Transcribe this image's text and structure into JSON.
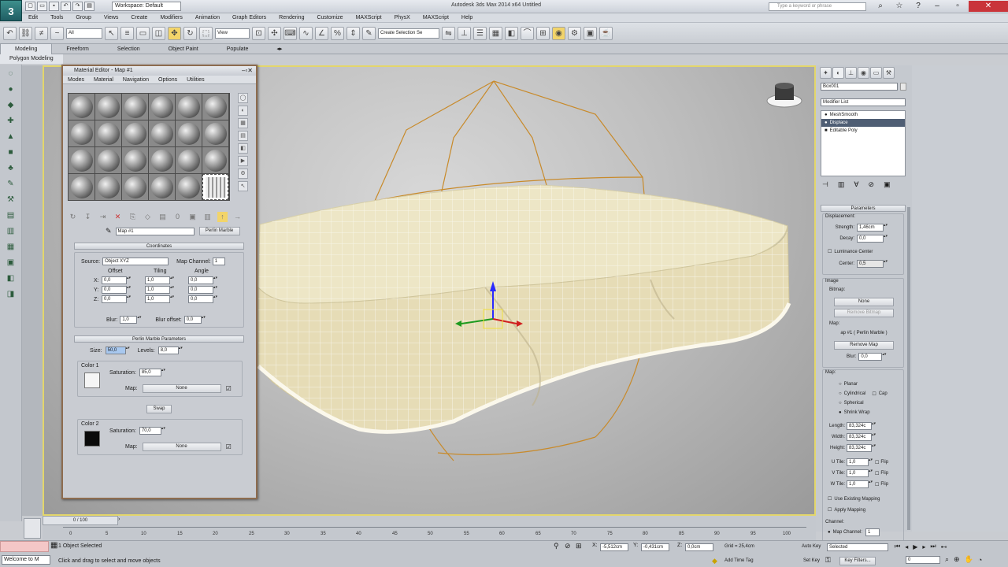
{
  "app": {
    "title": "Autodesk 3ds Max  2014 x64    Untitled",
    "logo": "3",
    "workspace": "Workspace: Default",
    "help_search_placeholder": "Type a keyword or phrase"
  },
  "menubar": [
    "Edit",
    "Tools",
    "Group",
    "Views",
    "Create",
    "Modifiers",
    "Animation",
    "Graph Editors",
    "Rendering",
    "Customize",
    "MAXScript",
    "PhysX",
    "MAXScript",
    "Help"
  ],
  "toolbar": {
    "selection_filter": "All",
    "ref_coord": "View",
    "named_selection": "Create Selection Se"
  },
  "ribbon": {
    "tabs": [
      "Modeling",
      "Freeform",
      "Selection",
      "Object Paint",
      "Populate"
    ],
    "active_tab": "Modeling",
    "sub": "Polygon Modeling"
  },
  "material_editor": {
    "title": "Material Editor - Map #1",
    "menu": [
      "Modes",
      "Material",
      "Navigation",
      "Options",
      "Utilities"
    ],
    "map_name": "Map #1",
    "map_type": "Perlin Marble",
    "coordinates": {
      "header": "Coordinates",
      "source_label": "Source:",
      "source_value": "Object XYZ",
      "map_channel_label": "Map Channel:",
      "map_channel_value": "1",
      "offset_label": "Offset",
      "tiling_label": "Tiling",
      "angle_label": "Angle",
      "axes": [
        "X:",
        "Y:",
        "Z:"
      ],
      "offset": [
        "0,0",
        "0,0",
        "0,0"
      ],
      "tiling": [
        "1,0",
        "1,0",
        "1,0"
      ],
      "angle": [
        "0,0",
        "0,0",
        "0,0"
      ],
      "blur_label": "Blur:",
      "blur_value": "1,0",
      "blur_offset_label": "Blur offset:",
      "blur_offset_value": "0,0"
    },
    "perlin": {
      "header": "Perlin Marble Parameters",
      "size_label": "Size:",
      "size_value": "50,0",
      "levels_label": "Levels:",
      "levels_value": "8,0",
      "color1_label": "Color 1",
      "color1_hex": "#f5f5f5",
      "sat_label": "Saturation:",
      "sat1": "85,0",
      "map_label": "Map:",
      "map1": "None",
      "swap": "Swap",
      "color2_label": "Color 2",
      "color2_hex": "#0a0a0a",
      "sat2": "70,0",
      "map2": "None"
    }
  },
  "command_panel": {
    "object_name": "Box001",
    "modifier_list": "Modifier List",
    "stack": [
      "MeshSmooth",
      "Displace",
      "Editable Poly"
    ],
    "selected_modifier": "Displace",
    "parameters_header": "Parameters",
    "displacement_label": "Displacement:",
    "strength_label": "Strength:",
    "strength_value": "1,46cm",
    "decay_label": "Decay:",
    "decay_value": "0,0",
    "luminance_center": "Luminance Center",
    "center_label": "Center:",
    "center_value": "0,5",
    "image_label": "Image",
    "bitmap_label": "Bitmap:",
    "bitmap_btn": "None",
    "remove_bitmap": "Remove Bitmap",
    "map_label": "Map:",
    "map_value": "ap #1 ( Perlin Marble )",
    "remove_map": "Remove Map",
    "blur_label": "Blur:",
    "blur_value": "0,0",
    "map_section": "Map:",
    "mapping_options": [
      "Planar",
      "Cylindrical",
      "Spherical",
      "Shrink Wrap"
    ],
    "cap_label": "Cap",
    "selected_mapping": "Shrink Wrap",
    "length_label": "Length:",
    "length_value": "83,324c",
    "width_label": "Width:",
    "width_value": "83,324c",
    "height_label": "Height:",
    "height_value": "83,324c",
    "utile_label": "U Tile:",
    "vtile_label": "V Tile:",
    "wtile_label": "W Tile:",
    "tile_value": "1,0",
    "flip_label": "Flip",
    "use_existing": "Use Existing Mapping",
    "apply_mapping": "Apply Mapping",
    "channel_label": "Channel:",
    "map_channel": "Map Channel:",
    "map_channel_value": "1"
  },
  "timeline": {
    "frame_display": "0 / 100",
    "ticks": [
      "0",
      "5",
      "10",
      "15",
      "20",
      "25",
      "30",
      "35",
      "40",
      "45",
      "50",
      "55",
      "60",
      "65",
      "70",
      "75",
      "80",
      "85",
      "90",
      "95",
      "100"
    ]
  },
  "status": {
    "welcome": "Welcome to M",
    "selected_text": "1 Object Selected",
    "prompt": "Click and drag to select and move objects",
    "x_value": "-5,512cm",
    "y_value": "-0,431cm",
    "z_value": "0,0cm",
    "grid": "Grid = 25,4cm",
    "add_time_tag": "Add Time Tag",
    "auto_key": "Auto Key",
    "set_key": "Set Key",
    "key_mode": "Selected",
    "key_filters": "Key Filters...",
    "frame": "0"
  }
}
